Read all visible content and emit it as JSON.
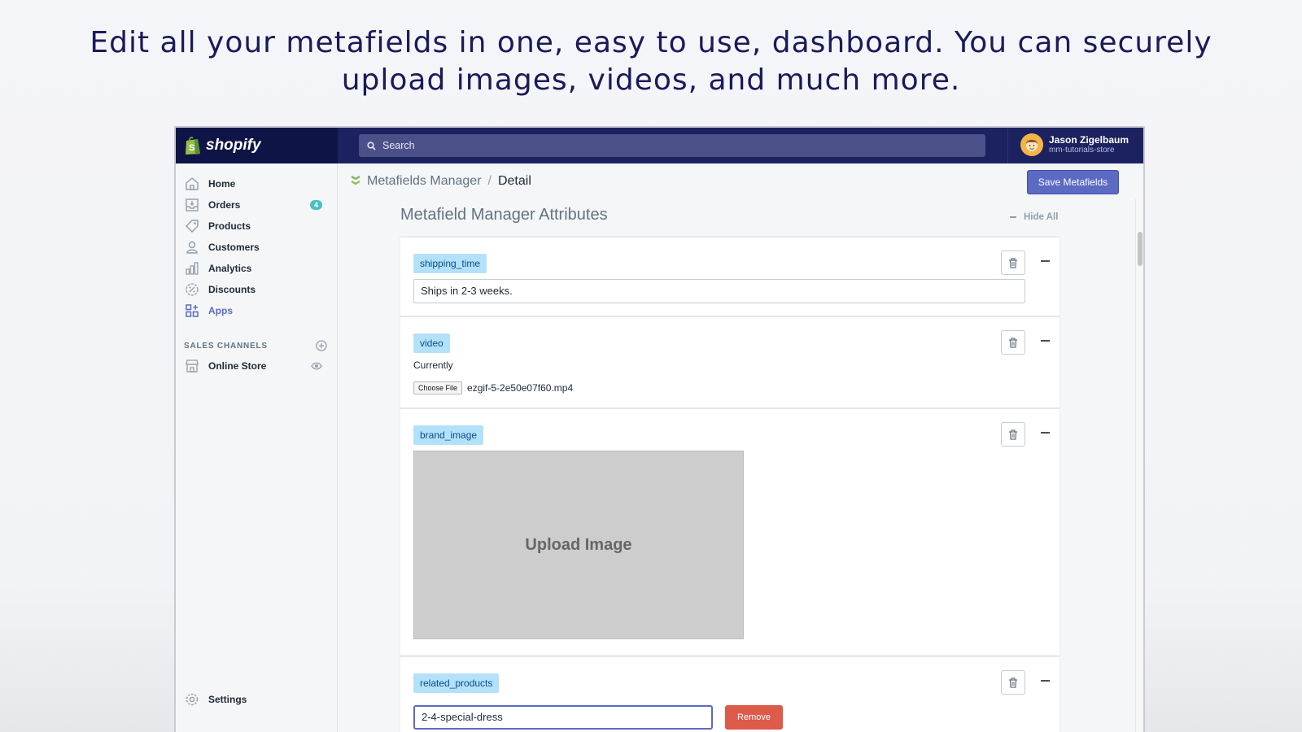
{
  "headline": {
    "line1": "Edit all your metafields in one, easy to use, dashboard. You can securely",
    "line2": "upload images, videos, and much more."
  },
  "topbar": {
    "brand": "shopify",
    "search_placeholder": "Search",
    "user_name": "Jason Zigelbaum",
    "user_store": "mm-tutorials-store"
  },
  "sidebar": {
    "items": [
      {
        "label": "Home",
        "icon": "home-icon"
      },
      {
        "label": "Orders",
        "icon": "orders-icon",
        "badge": "4"
      },
      {
        "label": "Products",
        "icon": "tag-icon"
      },
      {
        "label": "Customers",
        "icon": "person-icon"
      },
      {
        "label": "Analytics",
        "icon": "bar-chart-icon"
      },
      {
        "label": "Discounts",
        "icon": "discount-icon"
      },
      {
        "label": "Apps",
        "icon": "apps-icon",
        "active": true
      }
    ],
    "sales_channels_label": "SALES CHANNELS",
    "online_store": "Online Store",
    "settings": "Settings"
  },
  "breadcrumb": {
    "app": "Metafields Manager",
    "separator": "/",
    "current": "Detail"
  },
  "toolbar": {
    "save_label": "Save Metafields"
  },
  "section": {
    "title": "Metafield Manager Attributes",
    "hide_all": "Hide All"
  },
  "metafields": {
    "shipping_time": {
      "key": "shipping_time",
      "value": "Ships in 2-3 weeks."
    },
    "video": {
      "key": "video",
      "currently": "Currently",
      "choose_file": "Choose File",
      "file_name": "ezgif-5-2e50e07f60.mp4"
    },
    "brand_image": {
      "key": "brand_image",
      "upload_label": "Upload Image"
    },
    "related_products": {
      "key": "related_products",
      "value": "2-4-special-dress",
      "remove_label": "Remove"
    }
  },
  "colors": {
    "topbar": "#1c2260",
    "accent": "#5c6ac4",
    "tag_bg": "#b4e1fa",
    "remove": "#de5a4a",
    "headline": "#1a1a5a"
  }
}
